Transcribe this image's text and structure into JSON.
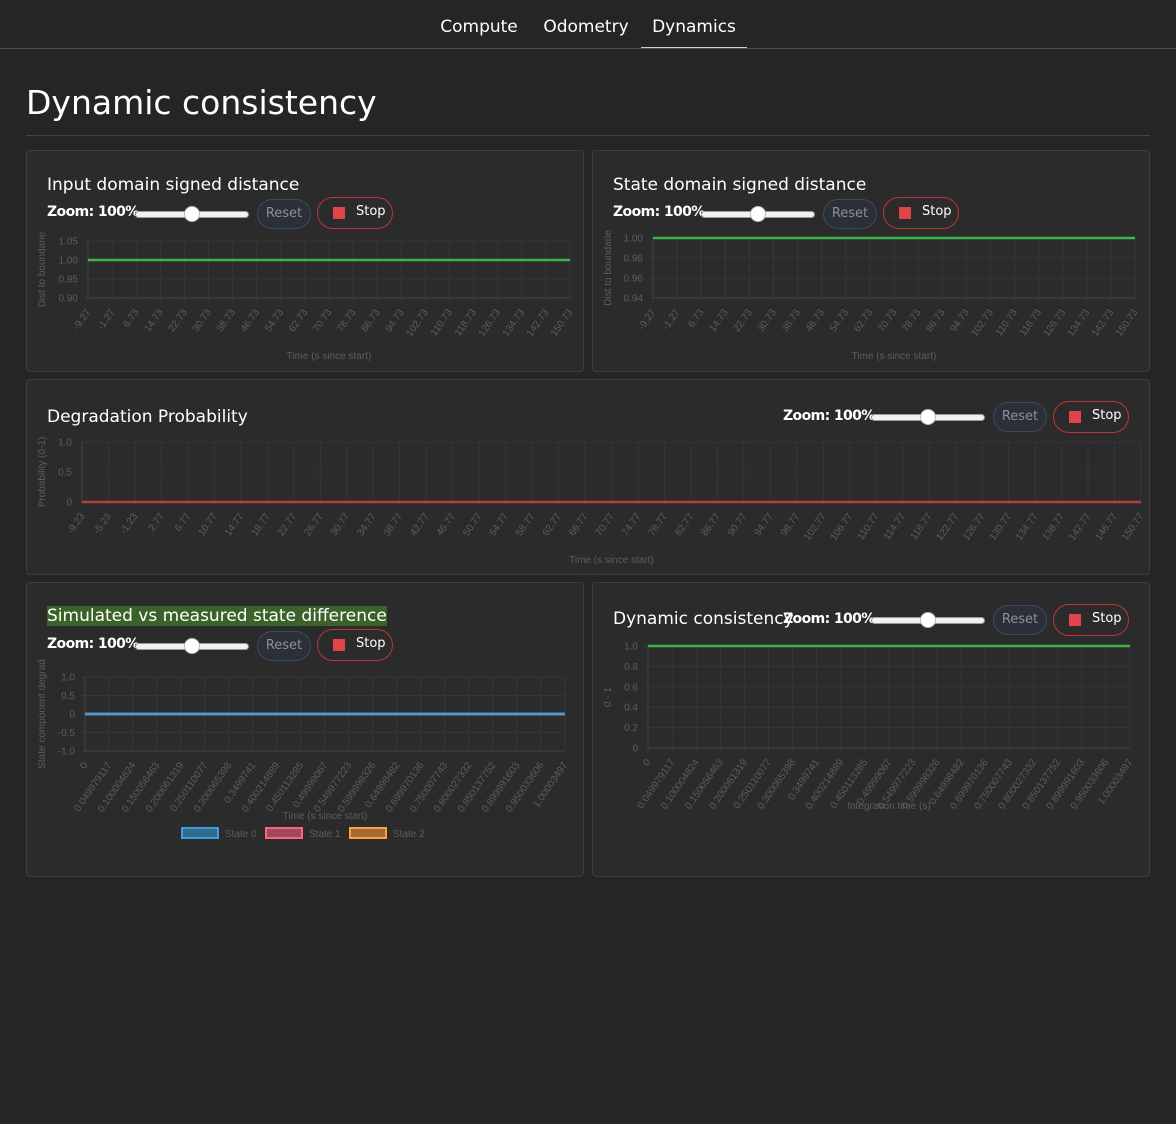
{
  "tabs": [
    {
      "label": "Compute"
    },
    {
      "label": "Odometry"
    },
    {
      "label": "Dynamics"
    }
  ],
  "page": {
    "title": "Dynamic consistency"
  },
  "panels": {
    "input": {
      "title": "Input domain signed distance",
      "zoom": "Zoom: 100%",
      "reset": "Reset",
      "stop": "Stop"
    },
    "state": {
      "title": "State domain signed distance",
      "zoom": "Zoom: 100%",
      "reset": "Reset",
      "stop": "Stop"
    },
    "degradation": {
      "title": "Degradation Probability",
      "zoom": "Zoom: 100%",
      "reset": "Reset",
      "stop": "Stop"
    },
    "simulated": {
      "title": "Simulated vs measured state difference",
      "zoom": "Zoom: 100%",
      "reset": "Reset",
      "stop": "Stop"
    },
    "dynamic": {
      "title": "Dynamic consistency",
      "zoom": "Zoom: 100%",
      "reset": "Reset",
      "stop": "Stop"
    }
  },
  "colors": {
    "accent_green": "#3db54a",
    "accent_red": "#b83c3c",
    "accent_blue": "#3a9ee0",
    "stop_red": "#e04448"
  },
  "chart_data": [
    {
      "id": "input",
      "type": "line",
      "title": "Input domain signed distance",
      "xlabel": "Time (s since start)",
      "ylabel": "Dist to boundarie",
      "x": [
        "-9.27",
        "-1.27",
        "6.73",
        "14.73",
        "22.73",
        "30.73",
        "38.73",
        "46.73",
        "54.73",
        "62.73",
        "70.73",
        "78.73",
        "86.73",
        "94.73",
        "102.73",
        "110.73",
        "118.73",
        "126.73",
        "134.73",
        "142.73",
        "150.73"
      ],
      "yticks": [
        "1.05",
        "1.00",
        "0.95",
        "0.90"
      ],
      "ylim": [
        0.9,
        1.05
      ],
      "series": [
        {
          "color": "#3db54a",
          "values": [
            1,
            1,
            1,
            1,
            1,
            1,
            1,
            1,
            1,
            1,
            1,
            1,
            1,
            1,
            1,
            1,
            1,
            1,
            1,
            1,
            1
          ]
        }
      ],
      "grid": true
    },
    {
      "id": "state",
      "type": "line",
      "title": "State domain signed distance",
      "xlabel": "Time (s since start)",
      "ylabel": "Dist to boundarie",
      "x": [
        "-9.27",
        "-1.27",
        "6.73",
        "14.73",
        "22.73",
        "30.73",
        "38.73",
        "46.73",
        "54.73",
        "62.73",
        "70.73",
        "78.73",
        "86.73",
        "94.73",
        "102.73",
        "110.73",
        "118.73",
        "126.73",
        "134.73",
        "142.73",
        "150.73"
      ],
      "yticks": [
        "1.00",
        "0.98",
        "0.96",
        "0.94"
      ],
      "ylim": [
        0.94,
        1.0
      ],
      "series": [
        {
          "color": "#3db54a",
          "values": [
            1,
            1,
            1,
            1,
            1,
            1,
            1,
            1,
            1,
            1,
            1,
            1,
            1,
            1,
            1,
            1,
            1,
            1,
            1,
            1,
            1
          ]
        }
      ],
      "grid": true
    },
    {
      "id": "degradation",
      "type": "line",
      "title": "Degradation Probability",
      "xlabel": "Time (s since start)",
      "ylabel": "Probability (0-1)",
      "x": [
        "-9.23",
        "-5.23",
        "-1.23",
        "2.77",
        "6.77",
        "10.77",
        "14.77",
        "18.77",
        "22.77",
        "26.77",
        "30.77",
        "34.77",
        "38.77",
        "42.77",
        "46.77",
        "50.77",
        "54.77",
        "58.77",
        "62.77",
        "66.77",
        "70.77",
        "74.77",
        "78.77",
        "82.77",
        "86.77",
        "90.77",
        "94.77",
        "98.77",
        "102.77",
        "106.77",
        "110.77",
        "114.77",
        "118.77",
        "122.77",
        "126.77",
        "130.77",
        "134.77",
        "138.77",
        "142.77",
        "146.77",
        "150.77"
      ],
      "yticks": [
        "1.0",
        "0.5",
        "0"
      ],
      "ylim": [
        0,
        1
      ],
      "series": [
        {
          "color": "#b83c3c",
          "values": [
            0
          ]
        }
      ],
      "grid": true
    },
    {
      "id": "simulated",
      "type": "line",
      "title": "Simulated vs measured state difference",
      "xlabel": "Time (s since start)",
      "ylabel": "State component degrad",
      "x": [
        "0",
        "0.049979117",
        "0.100004824",
        "0.150056463",
        "0.200061319",
        "0.250110077",
        "0.300065398",
        "0.3499741",
        "0.400214889",
        "0.450113285",
        "0.49999067",
        "0.549977223",
        "0.599998326",
        "0.64998482",
        "0.699970136",
        "0.750007743",
        "0.800027332",
        "0.850137752",
        "0.899991603",
        "0.950033606",
        "1.00003497"
      ],
      "yticks": [
        "1.0",
        "0.5",
        "0",
        "-0.5",
        "-1.0"
      ],
      "ylim": [
        -1,
        1
      ],
      "series": [
        {
          "name": "State 0",
          "color": "#3a9ee0",
          "values": [
            0
          ]
        },
        {
          "name": "State 1",
          "color": "#ff6384",
          "values": [
            0
          ]
        },
        {
          "name": "State 2",
          "color": "#ff9f40",
          "values": [
            0
          ]
        }
      ],
      "legend": "bottom",
      "grid": true
    },
    {
      "id": "dynamic",
      "type": "line",
      "title": "Dynamic consistency",
      "xlabel": "Integration time (s)",
      "ylabel": "0 - 1",
      "x": [
        "0",
        "0.049979117",
        "0.100004824",
        "0.150056463",
        "0.200061319",
        "0.250110077",
        "0.300065398",
        "0.3499741",
        "0.400214889",
        "0.450113285",
        "0.49999067",
        "0.549977223",
        "0.599998326",
        "0.64998482",
        "0.699970136",
        "0.750007743",
        "0.800027332",
        "0.850137752",
        "0.899991603",
        "0.950033606",
        "1.00003497"
      ],
      "yticks": [
        "1.0",
        "0.8",
        "0.6",
        "0.4",
        "0.2",
        "0"
      ],
      "ylim": [
        0,
        1
      ],
      "series": [
        {
          "color": "#3db54a",
          "values": [
            1
          ]
        }
      ],
      "grid": true
    }
  ]
}
